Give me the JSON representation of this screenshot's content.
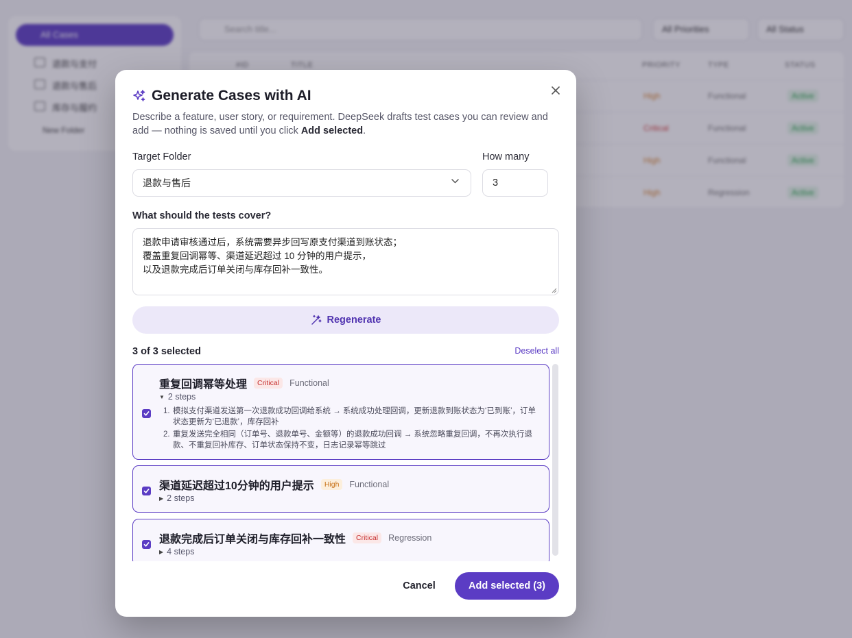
{
  "background": {
    "sidebar": {
      "all_label": "All Cases",
      "folders": [
        "退款与支付",
        "退款与售后",
        "库存与履约"
      ],
      "new_folder": "New Folder"
    },
    "search_placeholder": "Search title...",
    "priority_filter": "All Priorities",
    "status_filter": "All Status",
    "table_headers": [
      "#ID",
      "TITLE",
      "PRIORITY",
      "TYPE",
      "STATUS"
    ],
    "rows": [
      {
        "priority": "High",
        "type": "Functional",
        "status": "Active"
      },
      {
        "priority": "Critical",
        "type": "Functional",
        "status": "Active"
      },
      {
        "priority": "High",
        "type": "Functional",
        "status": "Active"
      },
      {
        "priority": "High",
        "type": "Regression",
        "status": "Active"
      }
    ]
  },
  "modal": {
    "title": "Generate Cases with AI",
    "description_pre": "Describe a feature, user story, or requirement. DeepSeek drafts test cases you can review and add — nothing is saved until you click ",
    "description_bold": "Add selected",
    "description_post": ".",
    "target_folder_label": "Target Folder",
    "target_folder_value": "退款与售后",
    "how_many_label": "How many",
    "how_many_value": "3",
    "cover_label": "What should the tests cover?",
    "cover_text": "退款申请审核通过后，系统需要异步回写原支付渠道到账状态；\n覆盖重复回调幂等、渠道延迟超过 10 分钟的用户提示，\n以及退款完成后订单关闭与库存回补一致性。",
    "regenerate_label": "Regenerate",
    "selection_count": "3 of 3 selected",
    "deselect_all": "Deselect all",
    "cases": [
      {
        "title": "重复回调幂等处理",
        "priority": "Critical",
        "type": "Functional",
        "steps_label": "2 steps",
        "expanded": true,
        "steps": [
          "模拟支付渠道发送第一次退款成功回调给系统 → 系统成功处理回调，更新退款到账状态为‘已到账’，订单状态更新为‘已退款’，库存回补",
          "重复发送完全相同（订单号、退款单号、金额等）的退款成功回调 → 系统忽略重复回调，不再次执行退款、不重复回补库存、订单状态保持不变，日志记录幂等跳过"
        ]
      },
      {
        "title": "渠道延迟超过10分钟的用户提示",
        "priority": "High",
        "type": "Functional",
        "steps_label": "2 steps",
        "expanded": false
      },
      {
        "title": "退款完成后订单关闭与库存回补一致性",
        "priority": "Critical",
        "type": "Regression",
        "steps_label": "4 steps",
        "expanded": false
      }
    ],
    "cancel_label": "Cancel",
    "add_label": "Add selected (3)"
  },
  "colors": {
    "accent": "#5b3cc4",
    "critical": "#c62f2f",
    "high": "#c87218"
  }
}
